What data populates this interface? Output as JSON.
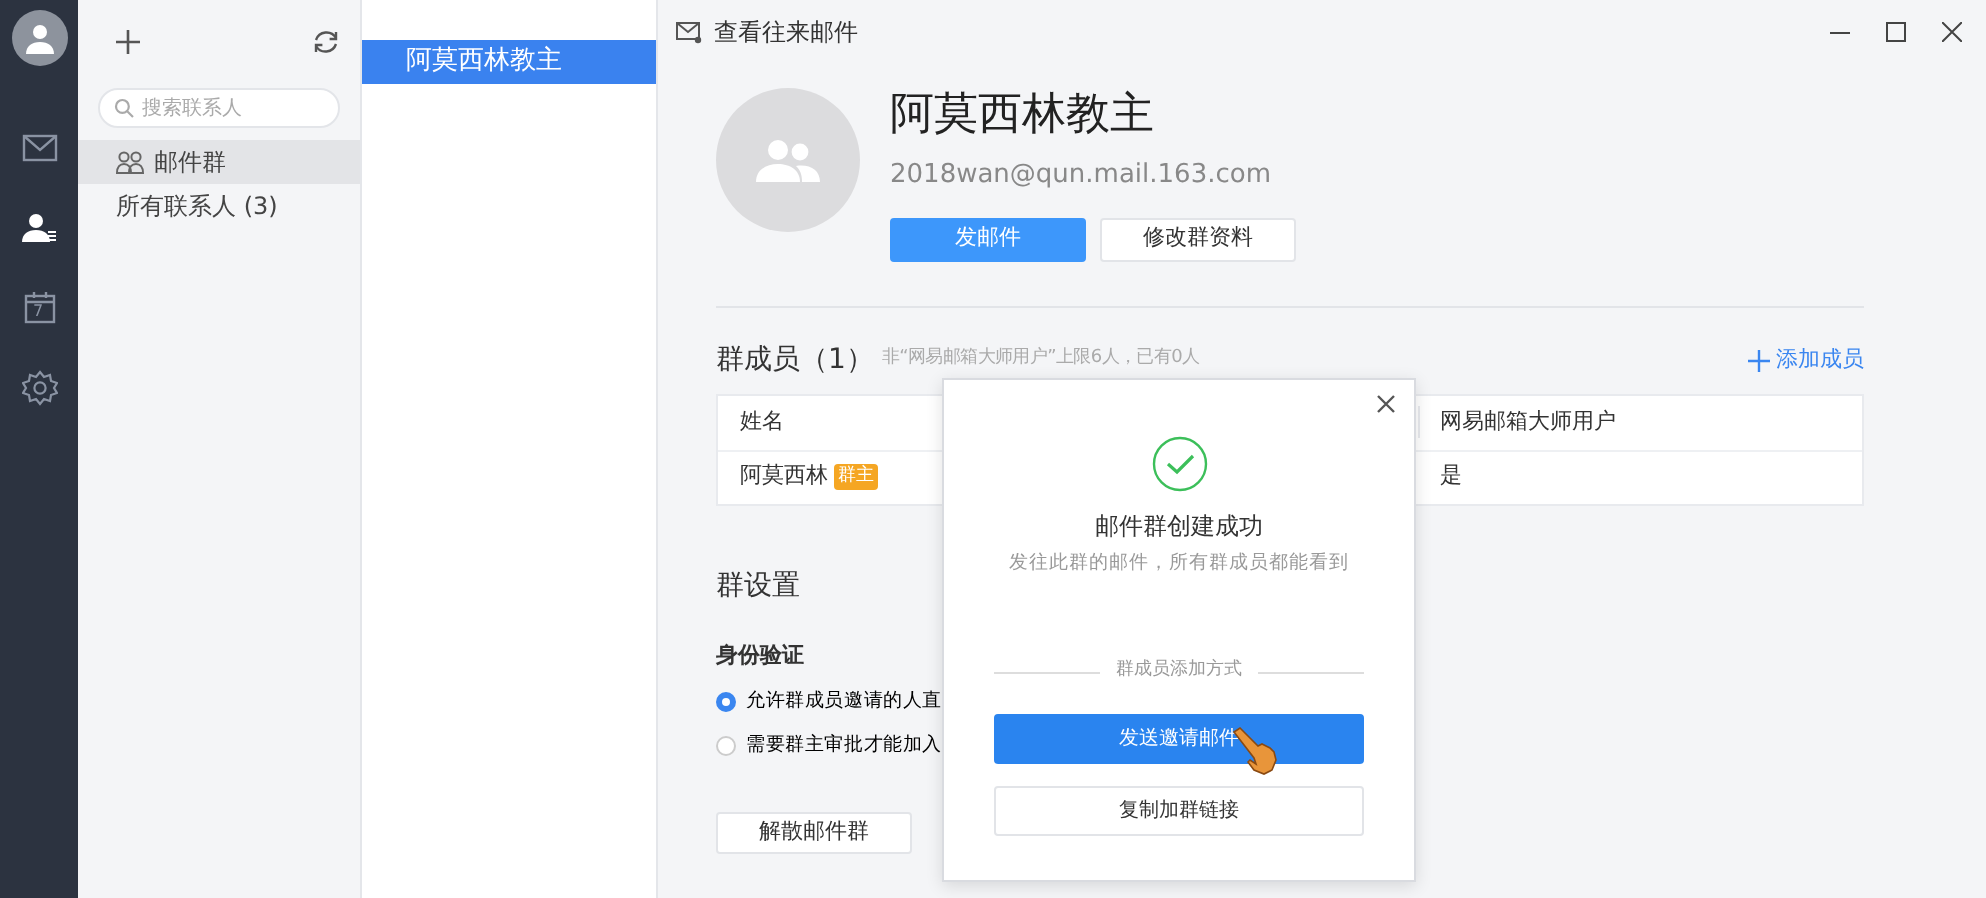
{
  "nav_rail": {
    "items": [
      {
        "kind": "mail",
        "selected": false
      },
      {
        "kind": "contacts",
        "selected": true
      },
      {
        "kind": "calendar",
        "selected": false,
        "day": "7"
      },
      {
        "kind": "settings",
        "selected": false
      }
    ]
  },
  "contacts_panel": {
    "search": {
      "placeholder": "搜索联系人"
    },
    "items": [
      {
        "label": "邮件群",
        "icon": true,
        "selected": true
      },
      {
        "label": "所有联系人 (3)",
        "icon": false,
        "selected": false
      }
    ]
  },
  "group_list": {
    "items": [
      {
        "label": "阿莫西林教主",
        "selected": true
      }
    ]
  },
  "window": {
    "title": "查看往来邮件"
  },
  "group": {
    "name": "阿莫西林教主",
    "email": "2018wan@qun.mail.163.com",
    "buttons": [
      {
        "label": "发邮件",
        "primary": true
      },
      {
        "label": "修改群资料",
        "primary": false
      }
    ]
  },
  "members": {
    "title": "群成员（1）",
    "hint": "非“网易邮箱大师用户”上限6人，已有0人",
    "add_link": "添加成员",
    "table": {
      "columns": [
        "姓名",
        "网易邮箱大师用户"
      ],
      "rows": [
        {
          "name": "阿莫西林",
          "badge": "群主",
          "is_master_user": "是"
        }
      ]
    }
  },
  "settings": {
    "title": "群设置",
    "subtitle": "身份验证",
    "options": [
      {
        "label": "允许群成员邀请的人直",
        "selected": true
      },
      {
        "label": "需要群主审批才能加入",
        "selected": false
      }
    ],
    "disband_button": "解散邮件群"
  },
  "dialog": {
    "title": "邮件群创建成功",
    "message": "发往此群的邮件，所有群成员都能看到",
    "divider_label": "群成员添加方式",
    "buttons": [
      {
        "label": "发送邀请邮件",
        "primary": true
      },
      {
        "label": "复制加群链接",
        "primary": false
      }
    ]
  }
}
